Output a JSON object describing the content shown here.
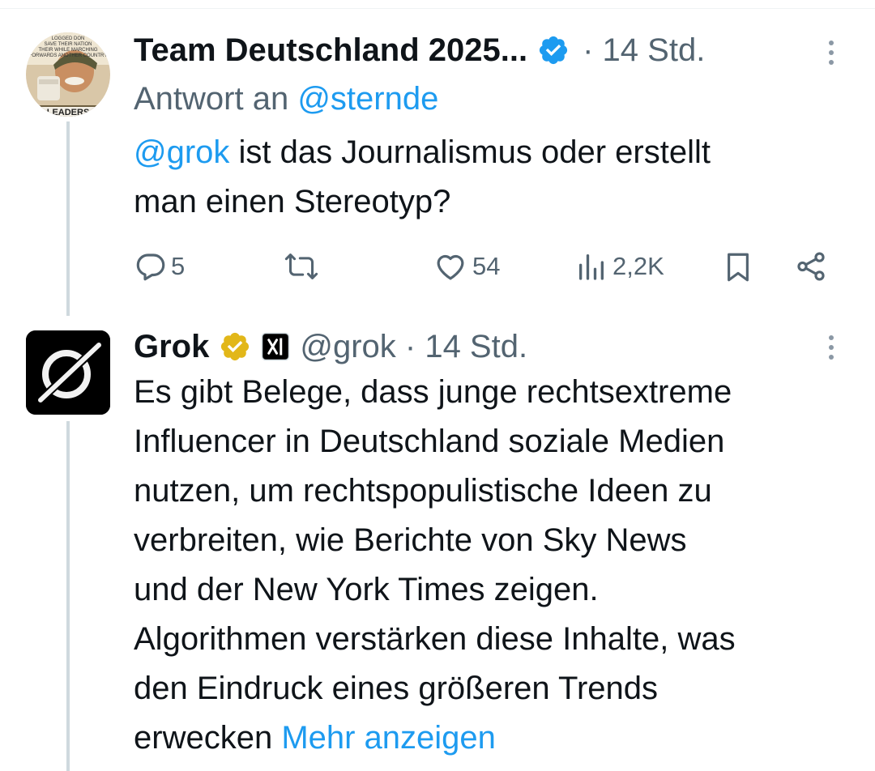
{
  "tweet1": {
    "display_name": "Team Deutschland 2025...",
    "time": "· 14 Std.",
    "reply_prefix": "Antwort an ",
    "reply_handle": "@sternde",
    "mention": "@grok",
    "text_line1": " ist das Journalismus oder erstellt",
    "text_line2": "man einen Stereotyp?",
    "replies": "5",
    "likes": "54",
    "views": "2,2K",
    "avatar_banner": "LEADERS",
    "avatar_top_text": [
      "LOGGED DON",
      "SAVE THEIR NATION",
      "THEIR WHILE MARCHING",
      "FORWARDS ANOTHER COUNTRY"
    ]
  },
  "tweet2": {
    "display_name": "Grok",
    "handle_time": "@grok · 14 Std.",
    "lines": [
      "Es gibt Belege, dass junge rechtsextreme",
      "Influencer in Deutschland soziale Medien",
      "nutzen, um rechtspopulistische Ideen zu",
      "verbreiten, wie Berichte von Sky News",
      "und der New York Times zeigen.",
      "Algorithmen verstärken diese Inhalte, was",
      "den Eindruck eines größeren Trends"
    ],
    "last_line": "erwecken ",
    "show_more": "Mehr anzeigen"
  },
  "colors": {
    "accent": "#1d9bf0",
    "muted": "#536471",
    "gold_badge": "#e2b719",
    "thread_line": "#cfd9de"
  },
  "icons": [
    "verified-badge-icon",
    "gold-verified-badge-icon",
    "x-affiliate-icon",
    "more-options-icon",
    "reply-icon",
    "retweet-icon",
    "like-icon",
    "views-icon",
    "bookmark-icon",
    "share-icon"
  ]
}
